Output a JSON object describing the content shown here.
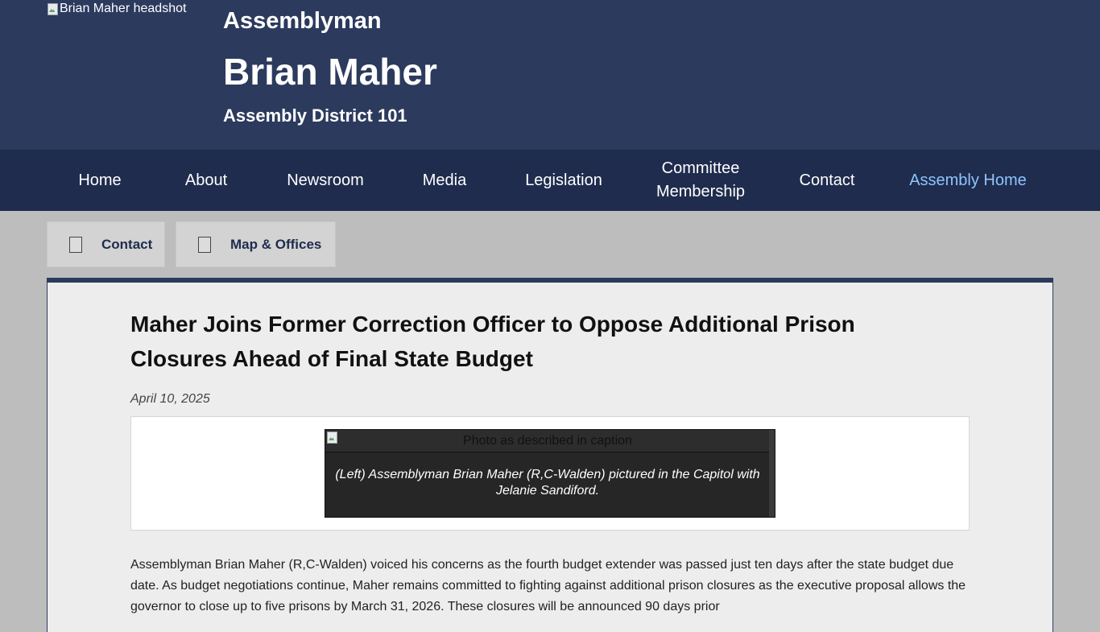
{
  "header": {
    "headshot_alt": "Brian Maher headshot",
    "title_prefix": "Assemblyman",
    "name": "Brian Maher",
    "district": "Assembly District 101"
  },
  "nav": {
    "items": [
      {
        "label": "Home"
      },
      {
        "label": "About"
      },
      {
        "label": "Newsroom"
      },
      {
        "label": "Media"
      },
      {
        "label": "Legislation"
      },
      {
        "label": "Committee\nMembership"
      },
      {
        "label": "Contact"
      },
      {
        "label": "Assembly Home",
        "active": true
      }
    ],
    "active_color": "#8fc3ff"
  },
  "quick_links": [
    {
      "label": "Contact",
      "icon": "contact-card-icon"
    },
    {
      "label": "Map & Offices",
      "icon": "map-icon"
    }
  ],
  "article": {
    "title": "Maher Joins Former Correction Officer to Oppose Additional Prison Closures Ahead of Final State Budget",
    "date": "April 10, 2025",
    "photo_alt": "Photo as described in caption",
    "caption": "(Left) Assemblyman Brian Maher (R,C-Walden) pictured in the Capitol with Jelanie Sandiford.",
    "body": "Assemblyman Brian Maher (R,C-Walden) voiced his concerns as the fourth budget extender was passed just ten days after the state budget due date. As budget negotiations continue, Maher remains committed to fighting against additional prison closures as the executive proposal allows the governor to close up to five prisons by March 31, 2026. These closures will be announced 90 days prior"
  },
  "colors": {
    "header_bg": "#2c3a5e",
    "nav_bg": "#1f2c4d",
    "page_bg": "#bdbdbd",
    "panel_bg": "#ededed"
  }
}
